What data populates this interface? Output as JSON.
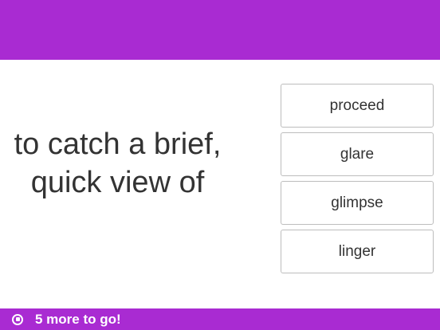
{
  "theme": {
    "accent": "#a92bd2",
    "text": "#333333",
    "choice_border": "#bdbdbd"
  },
  "question": {
    "prompt": "to catch a brief,\nquick view of"
  },
  "choices": [
    {
      "label": "proceed"
    },
    {
      "label": "glare"
    },
    {
      "label": "glimpse"
    },
    {
      "label": "linger"
    }
  ],
  "footer": {
    "stop_icon": "stop-circle-icon",
    "remaining_text": "5 more to go!"
  }
}
